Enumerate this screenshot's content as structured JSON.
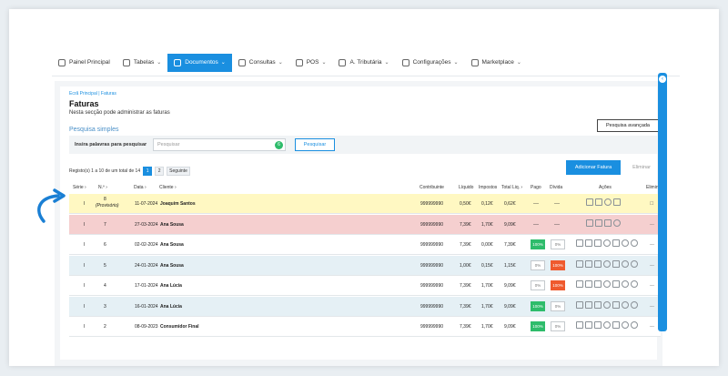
{
  "nav": {
    "items": [
      {
        "label": "Painel Principal",
        "icon": "dashboard-icon",
        "chevron": false
      },
      {
        "label": "Tabelas",
        "icon": "users-icon",
        "chevron": true
      },
      {
        "label": "Documentos",
        "icon": "document-icon",
        "chevron": true,
        "active": true
      },
      {
        "label": "Consultas",
        "icon": "chart-icon",
        "chevron": true
      },
      {
        "label": "POS",
        "icon": "pos-icon",
        "chevron": true
      },
      {
        "label": "A. Tributária",
        "icon": "scale-icon",
        "chevron": true
      },
      {
        "label": "Configurações",
        "icon": "settings-icon",
        "chevron": true
      },
      {
        "label": "Marketplace",
        "icon": "marketplace-icon",
        "chevron": true
      }
    ]
  },
  "breadcrumb": "Ecrã Principal  |  Faturas",
  "page": {
    "title": "Faturas",
    "subtitle": "Nesta secção pode administrar as faturas",
    "advanced_search": "Pesquisa avançada",
    "simple_search_title": "Pesquisa simples"
  },
  "search": {
    "label": "Insira palavras para pesquisar",
    "placeholder": "Pesquisar",
    "badge": "6",
    "button": "Pesquisar"
  },
  "pagination": {
    "records": "Registo(s) 1 a 10 de um total de 14",
    "pages": [
      "1",
      "2"
    ],
    "next": "Seguinte"
  },
  "actions": {
    "add": "Adicionar Fatura",
    "delete": "Eliminar"
  },
  "table": {
    "headers": {
      "serie": "Série ›",
      "num": "N.º ›",
      "data": "Data ›",
      "cliente": "Cliente ›",
      "contribuinte": "Contribuinte",
      "liquido": "Líquido",
      "impostos": "Impostos",
      "total": "Total Liq. ›",
      "pago": "Pago",
      "divida": "Dívida",
      "acoes": "Ações",
      "eliminar": "Eliminar"
    },
    "rows": [
      {
        "serie": "I",
        "num": "8",
        "num_note": "(Provisório)",
        "data": "11-07-2024",
        "cliente": "Joaquim Santos",
        "contribuinte": "999999990",
        "liquido": "0,50€",
        "impostos": "0,12€",
        "total": "0,62€",
        "pago": "---",
        "divida": "---",
        "style": "yellow",
        "paid_pill": false,
        "elim": "☐"
      },
      {
        "serie": "I",
        "num": "7",
        "num_note": "",
        "data": "27-03-2024",
        "cliente": "Ana Sousa",
        "contribuinte": "999999990",
        "liquido": "7,39€",
        "impostos": "1,70€",
        "total": "9,09€",
        "pago": "---",
        "divida": "---",
        "style": "red",
        "paid_pill": false,
        "elim": "---"
      },
      {
        "serie": "I",
        "num": "6",
        "num_note": "",
        "data": "02-02-2024",
        "cliente": "Ana Sousa",
        "contribuinte": "999999990",
        "liquido": "7,39€",
        "impostos": "0,00€",
        "total": "7,39€",
        "pago": "100%",
        "divida": "0%",
        "style": "white",
        "paid_pill": true,
        "debt_orange": false,
        "elim": "---"
      },
      {
        "serie": "I",
        "num": "5",
        "num_note": "",
        "data": "24-01-2024",
        "cliente": "Ana Sousa",
        "contribuinte": "999999990",
        "liquido": "1,00€",
        "impostos": "0,15€",
        "total": "1,15€",
        "pago": "0%",
        "divida": "100%",
        "style": "blue",
        "paid_pill": true,
        "debt_orange": true,
        "elim": "---"
      },
      {
        "serie": "I",
        "num": "4",
        "num_note": "",
        "data": "17-01-2024",
        "cliente": "Ana Lúcia",
        "contribuinte": "999999990",
        "liquido": "7,39€",
        "impostos": "1,70€",
        "total": "9,09€",
        "pago": "0%",
        "divida": "100%",
        "style": "white",
        "paid_pill": true,
        "debt_orange": true,
        "elim": "---"
      },
      {
        "serie": "I",
        "num": "3",
        "num_note": "",
        "data": "16-01-2024",
        "cliente": "Ana Lúcia",
        "contribuinte": "999999990",
        "liquido": "7,39€",
        "impostos": "1,70€",
        "total": "9,09€",
        "pago": "100%",
        "divida": "0%",
        "style": "blue",
        "paid_pill": true,
        "debt_orange": false,
        "elim": "---"
      },
      {
        "serie": "I",
        "num": "2",
        "num_note": "",
        "data": "08-09-2023",
        "cliente": "Consumidor Final",
        "contribuinte": "999999990",
        "liquido": "7,39€",
        "impostos": "1,70€",
        "total": "9,09€",
        "pago": "100%",
        "divida": "0%",
        "style": "white",
        "paid_pill": true,
        "debt_orange": false,
        "elim": "---"
      }
    ]
  },
  "colors": {
    "accent": "#1a8fe0",
    "green": "#2ebc6b",
    "orange": "#ef5a2e",
    "draft_row": "#fff8c2",
    "cancelled_row": "#f5cfcf"
  }
}
